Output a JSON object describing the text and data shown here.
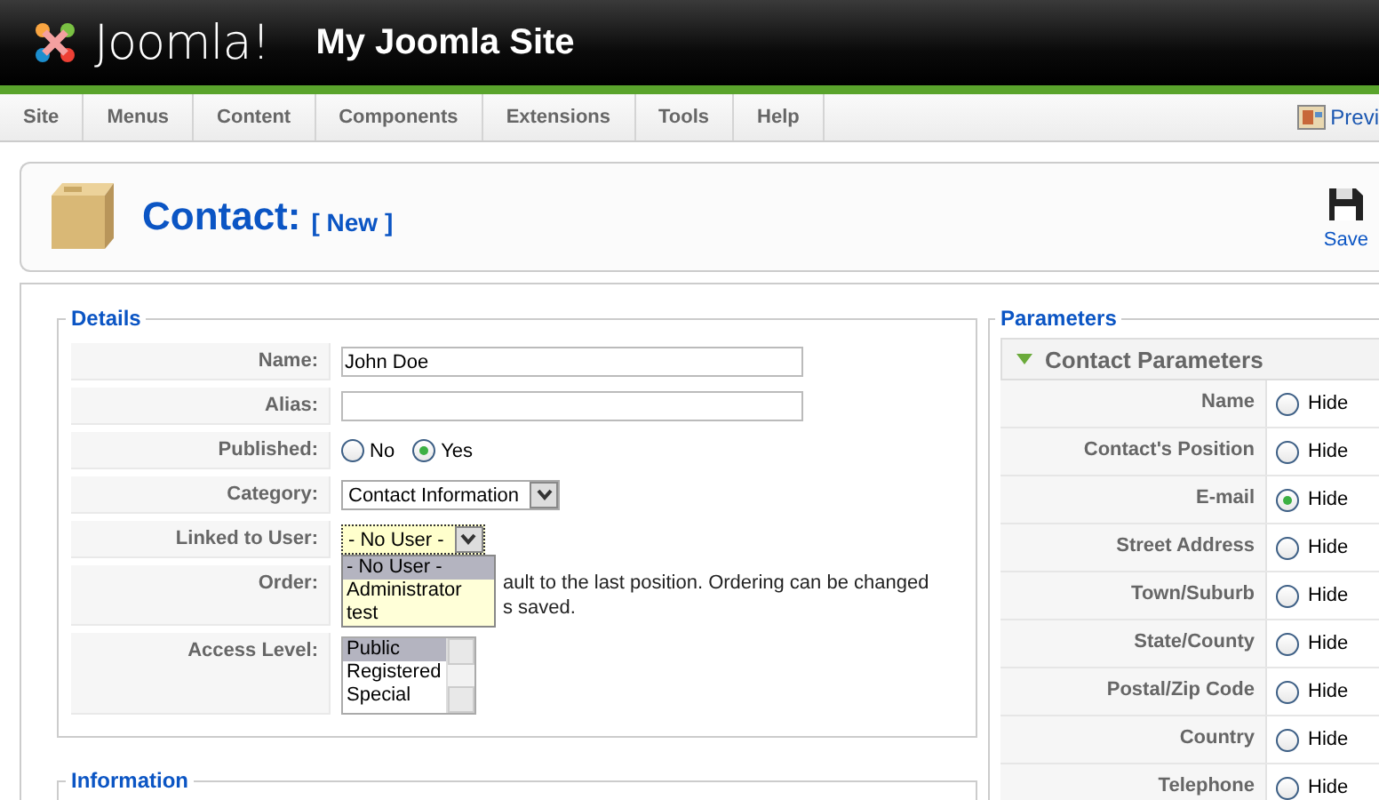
{
  "header": {
    "logo": "Joomla!",
    "site_name": "My Joomla Site"
  },
  "menu": [
    {
      "label": "Site"
    },
    {
      "label": "Menus"
    },
    {
      "label": "Content"
    },
    {
      "label": "Components"
    },
    {
      "label": "Extensions"
    },
    {
      "label": "Tools"
    },
    {
      "label": "Help"
    }
  ],
  "preview_link": "Previ",
  "toolbar": {
    "title": "Contact:",
    "subtitle": "[ New ]",
    "buttons": [
      {
        "label": "Save"
      }
    ]
  },
  "details": {
    "legend": "Details",
    "fields": [
      {
        "kind": "text",
        "label": "Name:",
        "value": "John Doe"
      },
      {
        "kind": "text",
        "label": "Alias:"
      },
      {
        "kind": "radio",
        "label": "Published:",
        "options": [
          {
            "label": "No",
            "selected": false
          },
          {
            "label": "Yes",
            "selected": true
          }
        ]
      },
      {
        "kind": "select",
        "label": "Category:",
        "value": "Contact Information"
      },
      {
        "kind": "dropdown",
        "label": "Linked to User:",
        "value": "- No User -",
        "expanded": true,
        "options": [
          {
            "label": "- No User -",
            "selected": true
          },
          {
            "label": "Administrator",
            "selected": false
          },
          {
            "label": "test",
            "selected": false
          }
        ]
      },
      {
        "kind": "note",
        "label": "Order:",
        "lines": [
          "ault to the last position. Ordering can be changed",
          "s saved."
        ]
      },
      {
        "kind": "list",
        "label": "Access Level:",
        "options": [
          {
            "label": "Public",
            "selected": true
          },
          {
            "label": "Registered",
            "selected": false
          },
          {
            "label": "Special",
            "selected": false
          }
        ]
      }
    ]
  },
  "information": {
    "legend": "Information"
  },
  "parameters": {
    "legend": "Parameters",
    "panel": {
      "title": "Contact Parameters",
      "expanded": true,
      "rows": [
        {
          "label": "Name",
          "option": "Hide",
          "selected": false
        },
        {
          "label": "Contact's Position",
          "option": "Hide",
          "selected": false
        },
        {
          "label": "E-mail",
          "option": "Hide",
          "selected": true
        },
        {
          "label": "Street Address",
          "option": "Hide",
          "selected": false
        },
        {
          "label": "Town/Suburb",
          "option": "Hide",
          "selected": false
        },
        {
          "label": "State/County",
          "option": "Hide",
          "selected": false
        },
        {
          "label": "Postal/Zip Code",
          "option": "Hide",
          "selected": false
        },
        {
          "label": "Country",
          "option": "Hide",
          "selected": false
        },
        {
          "label": "Telephone",
          "option": "Hide",
          "selected": false
        }
      ]
    }
  }
}
